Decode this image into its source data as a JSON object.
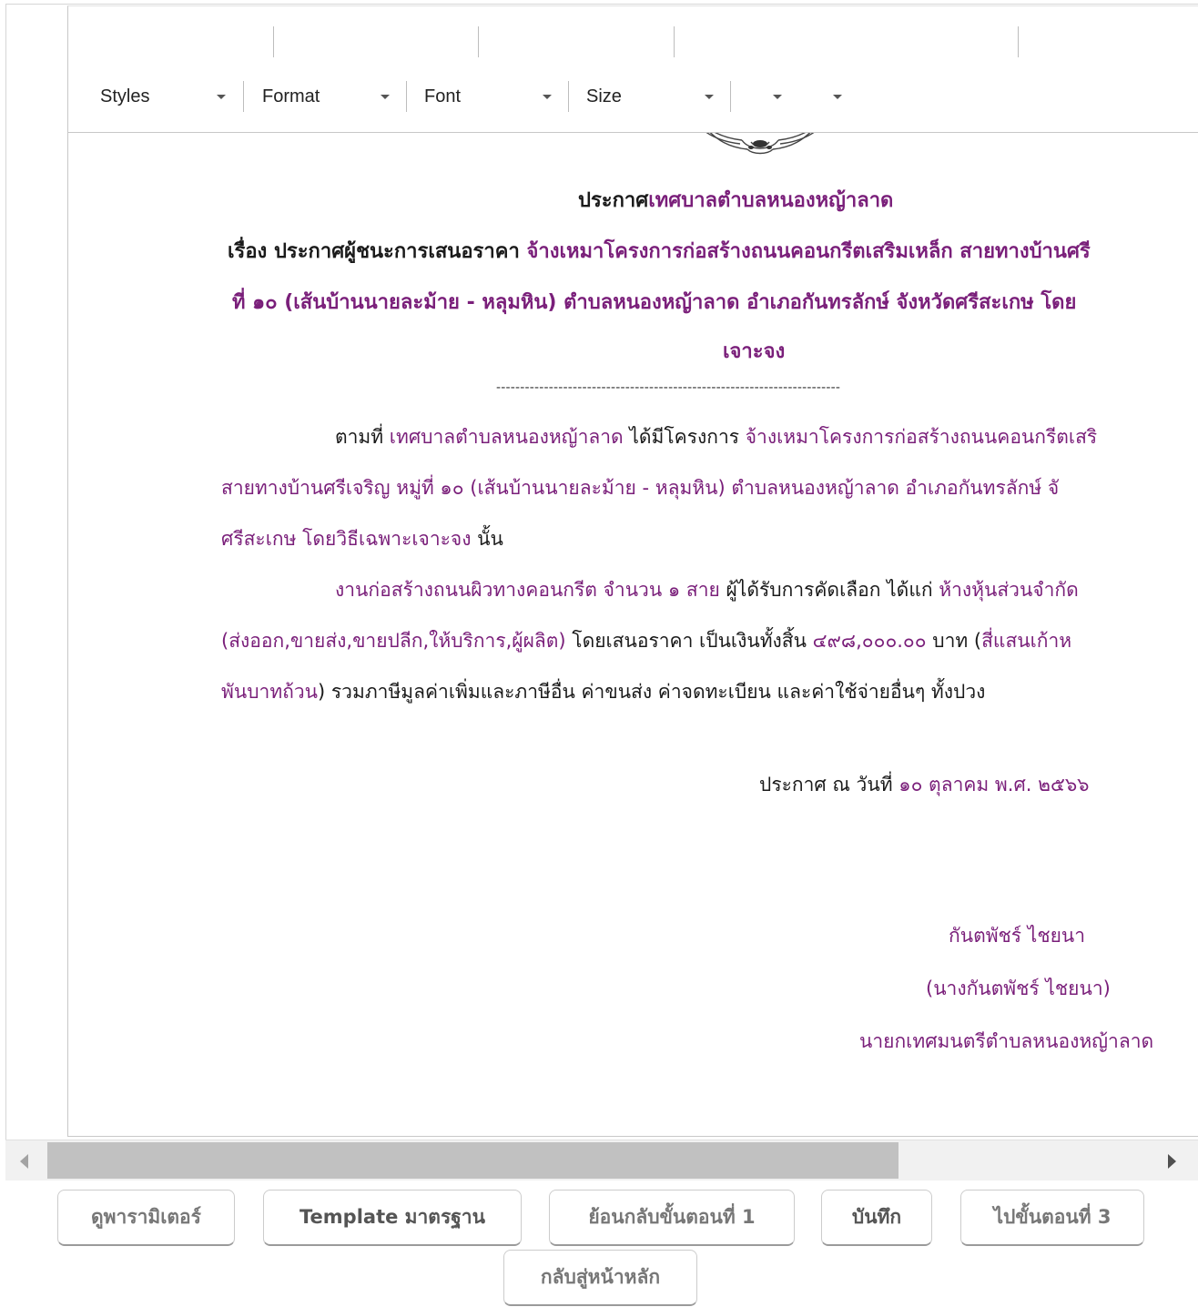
{
  "toolbar": {
    "styles_label": "Styles",
    "format_label": "Format",
    "font_label": "Font",
    "size_label": "Size"
  },
  "document": {
    "title_line1_prefix": "ประกาศ",
    "title_line1_org": "เทศบาลตำบลหนองหญ้าลาด",
    "title_line2_prefix": "เรื่อง ประกาศผู้ชนะการเสนอราคา ",
    "title_line2_project": "จ้างเหมาโครงการก่อสร้างถนนคอนกรีตเสริมเหล็ก สายทางบ้านศรี",
    "title_line3": "ที่ ๑๐ (เส้นบ้านนายละม้าย - หลุมหิน) ตำบลหนองหญ้าลาด อำเภอกันทรลักษ์ จังหวัดศรีสะเกษ โดย",
    "title_line4": "เจาะจง",
    "separator": "------------------------------------------------------------------------",
    "p1_line1_a": "ตามที่ ",
    "p1_line1_org": "เทศบาลตำบลหนองหญ้าลาด",
    "p1_line1_b": " ได้มีโครงการ ",
    "p1_line1_project": "จ้างเหมาโครงการก่อสร้างถนนคอนกรีตเสริ",
    "p1_line2": "สายทางบ้านศรีเจริญ หมู่ที่ ๑๐ (เส้นบ้านนายละม้าย - หลุมหิน) ตำบลหนองหญ้าลาด อำเภอกันทรลักษ์ จั",
    "p1_line3_method": "ศรีสะเกษ โดยวิธีเฉพาะเจาะจง",
    "p1_line3_end": "  นั้น",
    "p2_line1_work": "งานก่อสร้างถนนผิวทางคอนกรีต จำนวน ๑ สาย",
    "p2_line1_b": " ผู้ได้รับการคัดเลือก ได้แก่ ",
    "p2_line1_winner": "ห้างหุ้นส่วนจำกัด",
    "p2_line2_type": "(ส่งออก,ขายส่ง,ขายปลีก,ให้บริการ,ผู้ผลิต)",
    "p2_line2_b": " โดยเสนอราคา เป็นเงินทั้งสิ้น ",
    "p2_line2_amount": "๔๙๘,๐๐๐.๐๐",
    "p2_line2_c": " บาท (",
    "p2_line2_words": "สี่แสนเก้าห",
    "p2_line3_words": "พันบาทถ้วน",
    "p2_line3_rest": ") รวมภาษีมูลค่าเพิ่มและภาษีอื่น ค่าขนส่ง ค่าจดทะเบียน และค่าใช้จ่ายอื่นๆ ทั้งปวง",
    "announce_prefix": "ประกาศ ณ วันที่  ",
    "announce_date": "๑๐ ตุลาคม พ.ศ. ๒๕๖๖",
    "signature_name": "กันตพัชร์ ไชยนา",
    "signature_fullname": "(นางกันตพัชร์ ไชยนา)",
    "signature_position": "นายกเทศมนตรีตำบลหนองหญ้าลาด"
  },
  "buttons": {
    "view_params": "ดูพารามิเตอร์",
    "standard_template": "Template มาตรฐาน",
    "back_step1": "ย้อนกลับขั้นตอนที่ 1",
    "save": "บันทึก",
    "next_step3": "ไปขั้นตอนที่ 3",
    "home": "กลับสู่หน้าหลัก"
  },
  "colors": {
    "highlight_purple": "#7a1f7a"
  }
}
